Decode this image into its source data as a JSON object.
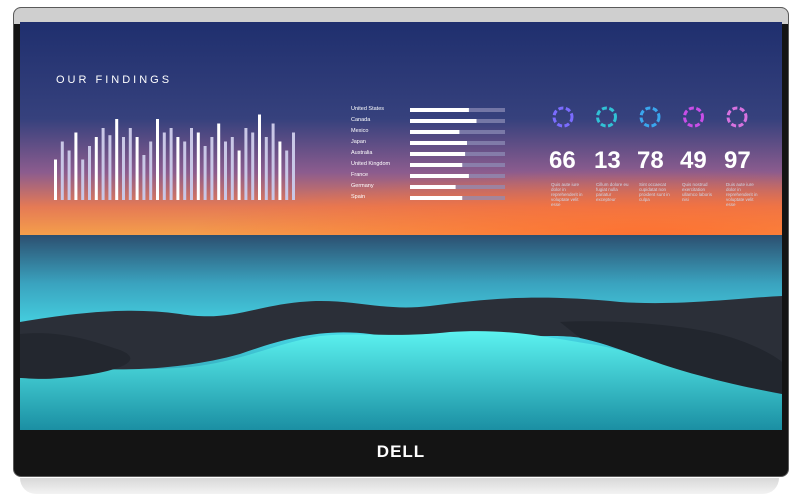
{
  "screen": {
    "title": "OUR FINDINGS",
    "brand": "DELL",
    "colors": {
      "sky_top": "#1c2d6e",
      "sky_glow": "#f07b3f",
      "sea": "#3ad6d8",
      "rocks": "#2b2e36",
      "bezel": "#141414"
    },
    "bar_chart": {
      "values": [
        0.45,
        0.65,
        0.55,
        0.75,
        0.45,
        0.6,
        0.7,
        0.8,
        0.72,
        0.9,
        0.7,
        0.8,
        0.7,
        0.5,
        0.65,
        0.9,
        0.75,
        0.8,
        0.7,
        0.65,
        0.8,
        0.75,
        0.6,
        0.7,
        0.85,
        0.65,
        0.7,
        0.55,
        0.8,
        0.75,
        0.95,
        0.7,
        0.85,
        0.65,
        0.55,
        0.75
      ]
    },
    "countries": [
      {
        "name": "United States",
        "value": 0.62
      },
      {
        "name": "Canada",
        "value": 0.7
      },
      {
        "name": "Mexico",
        "value": 0.52
      },
      {
        "name": "Japan",
        "value": 0.6
      },
      {
        "name": "Australia",
        "value": 0.58
      },
      {
        "name": "United Kingdom",
        "value": 0.55
      },
      {
        "name": "France",
        "value": 0.62
      },
      {
        "name": "Germany",
        "value": 0.48
      },
      {
        "name": "Spain",
        "value": 0.55
      }
    ],
    "stats": [
      {
        "value": "66",
        "color": "#7b6cff",
        "desc": "Quis aute iure dolor in reprehenderit in voluptate velit esse"
      },
      {
        "value": "13",
        "color": "#31c2d6",
        "desc": "Cillum dolore eu fugiat nulla pariatur excepteur"
      },
      {
        "value": "78",
        "color": "#3aa6ee",
        "desc": "Sint occaecat cupidatat non proident sunt in culpa"
      },
      {
        "value": "49",
        "color": "#c94ee8",
        "desc": "Quis nostrud exercitation ullamco laboris nisi"
      },
      {
        "value": "97",
        "color": "#d872e0",
        "desc": "Duis aute iure dolor in reprehenderit in voluptate velit esse"
      }
    ]
  }
}
